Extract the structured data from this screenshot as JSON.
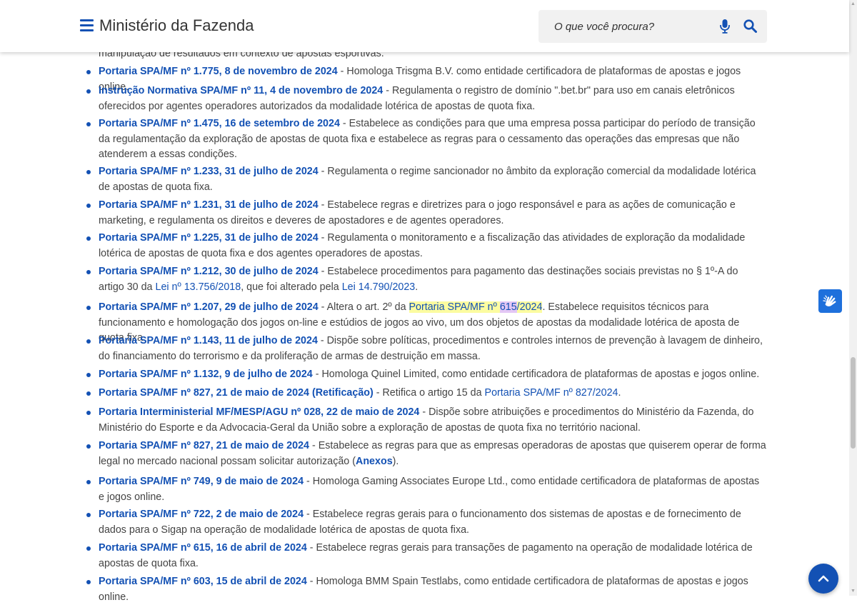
{
  "header": {
    "site_title": "Ministério da Fazenda",
    "search_placeholder": "O que você procura?"
  },
  "partial_top": "manipulação de resultados em contexto de apostas esportivas.",
  "items": [
    {
      "title": "Portaria SPA/MF  nº 1.775, 8 de novembro de 2024",
      "desc": " - Homologa Trisgma B.V. como entidade certificadora de plataformas de apostas e jogos online."
    },
    {
      "title": "Instrução Normativa SPA/MF nº 11, 4 de novembro de 2024",
      "desc": " - Regulamenta o registro de domínio \".bet.br\" para uso em canais eletrônicos oferecidos por agentes operadores autorizados da modalidade lotérica de apostas de quota fixa."
    },
    {
      "title": "Portaria SPA/MF nº 1.475, 16 de setembro de 2024",
      "desc": " - Estabelece as condições para que uma empresa possa participar do período de transição da regulamentação da exploração de apostas de quota fixa e estabelece as regras para o cessamento das operações das empresas que não atenderem a essas condições."
    },
    {
      "title": "Portaria SPA/MF nº 1.233, 31 de julho de 2024",
      "desc": " - Regulamenta o regime sancionador no âmbito da exploração comercial da modalidade lotérica de apostas de quota fixa."
    },
    {
      "title": "Portaria SPA/MF nº 1.231, 31 de julho de 2024",
      "desc": " - Estabelece regras e diretrizes para o jogo responsável e para as ações de comunicação e marketing, e regulamenta os direitos e deveres de apostadores e de agentes operadores."
    },
    {
      "title": "Portaria SPA/MF nº 1.225, 31 de julho de 2024",
      "desc": " - Regulamenta o monitoramento e a fiscalização das atividades de exploração da modalidade lotérica de apostas de quota fixa e dos agentes operadores de apostas."
    },
    {
      "title": "Portaria SPA/MF  nº 1.212, 30 de julho de 2024",
      "desc": " - Estabelece procedimentos para pagamento das destinações sociais previstas no § 1º-A do artigo 30 da ",
      "link1": "Lei nº 13.756/2018",
      "mid": ", que foi alterado pela ",
      "link2": "Lei 14.790/2023",
      "end": "."
    },
    {
      "title": "Portaria SPA/MF nº 1.207, 29 de julho de 2024",
      "desc": " - Altera o art. 2º da ",
      "link_a": "Portaria SPA/MF nº ",
      "link_b": "615",
      "link_c": "/2024",
      "end": ". Estabelece requisitos técnicos para funcionamento e homologação dos jogos on-line e estúdios de jogos ao vivo, um dos objetos de apostas da modalidade lotérica de aposta de quota fixa."
    },
    {
      "title": "Portaria SPA/MF nº 1.143, 11 de julho de 2024",
      "desc": " - Dispõe sobre políticas, procedimentos e controles internos de prevenção à lavagem de dinheiro, do financiamento do terrorismo e da proliferação de armas de destruição em massa."
    },
    {
      "title": "Portaria SPA/MF nº 1.132, 9 de julho de 2024",
      "desc": " - Homologa Quinel Limited, como entidade certificadora de plataformas de apostas e jogos online."
    },
    {
      "title": "Portaria SPA/MF nº 827, 21 de maio de 2024 (Retificação)",
      "desc": " - Retifica o artigo 15 da ",
      "link1": "Portaria SPA/MF nº 827/2024",
      "end": "."
    },
    {
      "title": "Portaria Interministerial MF/MESP/AGU nº 028, 22 de maio de 2024",
      "desc": " - Dispõe sobre atribuições e procedimentos do Ministério da Fazenda, do Ministério do Esporte e da Advocacia-Geral da União sobre a exploração de apostas de quota fixa no território nacional."
    },
    {
      "title": "Portaria SPA/MF nº 827, 21 de maio de 2024",
      "desc": " - Estabelece as regras para que as empresas operadoras de apostas que quiserem operar de forma legal no mercado nacional possam solicitar autorização (",
      "link1": "Anexos",
      "end": ")."
    },
    {
      "title": "Portaria SPA/MF nº 749, 9 de maio de 2024",
      "desc": " - Homologa Gaming Associates Europe Ltd., como entidade certificadora de plataformas de apostas e jogos online."
    },
    {
      "title": "Portaria SPA/MF nº 722, 2 de maio de 2024",
      "desc": " - Estabelece regras gerais para o funcionamento dos sistemas de apostas e de fornecimento de dados para o Sigap na operação de modalidade lotérica de apostas de quota fixa."
    },
    {
      "title": "Portaria SPA/MF nº 615, 16 de abril de 2024",
      "desc": " - Estabelece regras gerais para transações de pagamento na operação de modalidade lotérica de apostas de quota fixa."
    },
    {
      "title": "Portaria SPA/MF nº 603, 15 de abril de 2024",
      "desc": " - Homologa BMM Spain Testlabs, como entidade certificadora de plataformas de apostas e jogos online."
    }
  ],
  "colors": {
    "link": "#1351b4",
    "text": "#444444",
    "highlight": "#fcfca0"
  },
  "icons": [
    "menu-icon",
    "microphone-icon",
    "search-icon",
    "sign-language-icon",
    "chevron-up-icon"
  ]
}
